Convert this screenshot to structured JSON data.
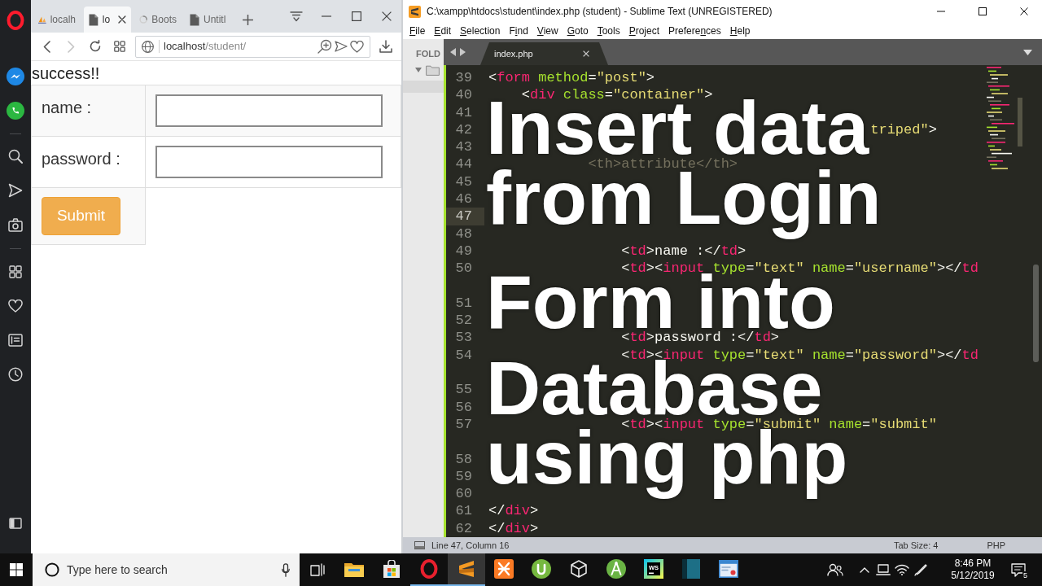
{
  "browser": {
    "tabs": [
      {
        "kind": "sails",
        "label": "localh",
        "selected": false
      },
      {
        "kind": "page",
        "label": "lo",
        "selected": true
      },
      {
        "kind": "loading",
        "label": "Boots",
        "selected": false
      },
      {
        "kind": "page",
        "label": "Untitl",
        "selected": false
      }
    ],
    "nav_buttons": [
      {
        "kind": "back",
        "disabled": false
      },
      {
        "kind": "forward",
        "disabled": true
      },
      {
        "kind": "reload",
        "disabled": false
      },
      {
        "kind": "grid",
        "disabled": false
      }
    ],
    "address": {
      "host": "localhost",
      "path": "/student/"
    },
    "page": {
      "message": "success!!",
      "rows": [
        {
          "kind": "input",
          "label": "name :"
        },
        {
          "kind": "input",
          "label": "password :"
        },
        {
          "kind": "submit",
          "button": "Submit"
        }
      ]
    }
  },
  "editor": {
    "title": "C:\\xampp\\htdocs\\student\\index.php (student) - Sublime Text (UNREGISTERED)",
    "menu": [
      {
        "key": "F",
        "after": "ile"
      },
      {
        "key": "E",
        "after": "dit"
      },
      {
        "key": "S",
        "after": "election"
      },
      {
        "before": "F",
        "key": "i",
        "after": "nd"
      },
      {
        "key": "V",
        "after": "iew"
      },
      {
        "key": "G",
        "after": "oto"
      },
      {
        "key": "T",
        "after": "ools"
      },
      {
        "key": "P",
        "after": "roject"
      },
      {
        "before": "Prefere",
        "key": "n",
        "after": "ces"
      },
      {
        "key": "H",
        "after": "elp"
      }
    ],
    "sidebar": {
      "heading": "FOLD"
    },
    "tab": {
      "label": "index.php"
    },
    "lines": [
      {
        "number": "39",
        "current": false,
        "wrapped": false,
        "code": [
          {
            "kind": "plain",
            "text": "<"
          },
          {
            "kind": "tag",
            "text": "form"
          },
          {
            "kind": "attr",
            "text": " method"
          },
          {
            "kind": "plain",
            "text": "="
          },
          {
            "kind": "string",
            "text": "\"post\""
          },
          {
            "kind": "plain",
            "text": ">"
          }
        ],
        "children": [
          {
            "number": "40",
            "current": false,
            "wrapped": false,
            "code": [
              {
                "kind": "plain",
                "text": "<"
              },
              {
                "kind": "tag",
                "text": "div"
              },
              {
                "kind": "attr",
                "text": " class"
              },
              {
                "kind": "plain",
                "text": "="
              },
              {
                "kind": "string",
                "text": "\"container\""
              },
              {
                "kind": "plain",
                "text": ">"
              }
            ],
            "children": [
              {
                "number": "41",
                "current": false,
                "wrapped": false
              }
            ]
          },
          {
            "number": "42",
            "current": false,
            "wrapped": false,
            "code": [
              {
                "kind": "string",
                "text": "triped\""
              },
              {
                "kind": "plain",
                "text": ">"
              }
            ],
            "children": [
              {
                "number": "43",
                "current": false,
                "wrapped": false,
                "children": [
                  {
                    "number": "44",
                    "current": false,
                    "wrapped": false,
                    "code": [
                      {
                        "kind": "comment",
                        "text": "<th>attribute</th>"
                      }
                    ]
                  },
                  {
                    "number": "45",
                    "current": false,
                    "wrapped": false
                  }
                ]
              },
              {
                "number": "46",
                "current": false,
                "wrapped": false
              },
              {
                "number": "47",
                "current": true,
                "wrapped": false,
                "children": [
                  {
                    "number": "48",
                    "current": false,
                    "wrapped": false,
                    "children": [
                      {
                        "number": "49",
                        "current": false,
                        "wrapped": false,
                        "code": [
                          {
                            "kind": "plain",
                            "text": "<"
                          },
                          {
                            "kind": "tag",
                            "text": "td"
                          },
                          {
                            "kind": "plain",
                            "text": ">name :</"
                          },
                          {
                            "kind": "tag",
                            "text": "td"
                          },
                          {
                            "kind": "plain",
                            "text": ">"
                          }
                        ]
                      },
                      {
                        "number": "50",
                        "current": false,
                        "wrapped": true,
                        "code": [
                          {
                            "kind": "plain",
                            "text": "<"
                          },
                          {
                            "kind": "tag",
                            "text": "td"
                          },
                          {
                            "kind": "plain",
                            "text": "><"
                          },
                          {
                            "kind": "tag",
                            "text": "input"
                          },
                          {
                            "kind": "attr",
                            "text": " type"
                          },
                          {
                            "kind": "plain",
                            "text": "="
                          },
                          {
                            "kind": "string",
                            "text": "\"text\""
                          },
                          {
                            "kind": "attr",
                            "text": " name"
                          },
                          {
                            "kind": "plain",
                            "text": "="
                          },
                          {
                            "kind": "string",
                            "text": "\"username\""
                          },
                          {
                            "kind": "plain",
                            "text": "></"
                          },
                          {
                            "kind": "tag",
                            "text": "td"
                          }
                        ]
                      }
                    ]
                  },
                  {
                    "number": "51",
                    "current": false,
                    "wrapped": false
                  },
                  {
                    "number": "52",
                    "current": false,
                    "wrapped": false,
                    "children": [
                      {
                        "number": "53",
                        "current": false,
                        "wrapped": false,
                        "code": [
                          {
                            "kind": "plain",
                            "text": "<"
                          },
                          {
                            "kind": "tag",
                            "text": "td"
                          },
                          {
                            "kind": "plain",
                            "text": ">password :</"
                          },
                          {
                            "kind": "tag",
                            "text": "td"
                          },
                          {
                            "kind": "plain",
                            "text": ">"
                          }
                        ]
                      },
                      {
                        "number": "54",
                        "current": false,
                        "wrapped": true,
                        "code": [
                          {
                            "kind": "plain",
                            "text": "<"
                          },
                          {
                            "kind": "tag",
                            "text": "td"
                          },
                          {
                            "kind": "plain",
                            "text": "><"
                          },
                          {
                            "kind": "tag",
                            "text": "input"
                          },
                          {
                            "kind": "attr",
                            "text": " type"
                          },
                          {
                            "kind": "plain",
                            "text": "="
                          },
                          {
                            "kind": "string",
                            "text": "\"text\""
                          },
                          {
                            "kind": "attr",
                            "text": " name"
                          },
                          {
                            "kind": "plain",
                            "text": "="
                          },
                          {
                            "kind": "string",
                            "text": "\"password\""
                          },
                          {
                            "kind": "plain",
                            "text": "></"
                          },
                          {
                            "kind": "tag",
                            "text": "td"
                          }
                        ]
                      }
                    ]
                  },
                  {
                    "number": "55",
                    "current": false,
                    "wrapped": false
                  },
                  {
                    "number": "56",
                    "current": false,
                    "wrapped": false,
                    "children": [
                      {
                        "number": "57",
                        "current": false,
                        "wrapped": true,
                        "code": [
                          {
                            "kind": "plain",
                            "text": "<"
                          },
                          {
                            "kind": "tag",
                            "text": "td"
                          },
                          {
                            "kind": "plain",
                            "text": "><"
                          },
                          {
                            "kind": "tag",
                            "text": "input"
                          },
                          {
                            "kind": "attr",
                            "text": " type"
                          },
                          {
                            "kind": "plain",
                            "text": "="
                          },
                          {
                            "kind": "string",
                            "text": "\"submit\""
                          },
                          {
                            "kind": "attr",
                            "text": " name"
                          },
                          {
                            "kind": "plain",
                            "text": "="
                          },
                          {
                            "kind": "string",
                            "text": "\"submit\""
                          }
                        ]
                      }
                    ]
                  },
                  {
                    "number": "58",
                    "current": false,
                    "wrapped": false
                  }
                ]
              },
              {
                "number": "59",
                "current": false,
                "wrapped": false
              }
            ]
          },
          {
            "number": "60",
            "current": false,
            "wrapped": false
          }
        ]
      },
      {
        "number": "61",
        "current": false,
        "wrapped": false,
        "code": [
          {
            "kind": "plain",
            "text": "</"
          },
          {
            "kind": "tag",
            "text": "div"
          },
          {
            "kind": "plain",
            "text": ">"
          }
        ]
      },
      {
        "number": "62",
        "current": false,
        "wrapped": false,
        "code": [
          {
            "kind": "plain",
            "text": "</"
          },
          {
            "kind": "tag",
            "text": "div"
          },
          {
            "kind": "plain",
            "text": ">"
          }
        ]
      }
    ],
    "overlay_title_lines": [
      "Insert data",
      "from Login",
      "Form into",
      "Database",
      "using php"
    ],
    "status": {
      "position": "Line 47, Column 16",
      "tab_size": "Tab Size: 4",
      "syntax": "PHP"
    }
  },
  "taskbar": {
    "search": {
      "placeholder": "Type here to search"
    },
    "apps": [
      {
        "kind": "folder",
        "running": false,
        "active": false
      },
      {
        "kind": "bag",
        "running": false,
        "active": false
      },
      {
        "kind": "ring",
        "running": true,
        "active": false
      },
      {
        "kind": "stripes",
        "running": true,
        "active": true
      },
      {
        "kind": "cross",
        "running": false,
        "active": false
      },
      {
        "kind": "circle",
        "running": false,
        "active": false
      },
      {
        "kind": "cube",
        "running": false,
        "active": false
      },
      {
        "kind": "compass",
        "running": false,
        "active": false
      },
      {
        "kind": "tile",
        "logo_text": "WS",
        "running": false,
        "active": false
      },
      {
        "kind": "panel",
        "running": false,
        "active": false
      },
      {
        "kind": "window",
        "running": false,
        "active": false
      }
    ],
    "clock": {
      "time": "8:46 PM",
      "date": "5/12/2019"
    },
    "notifications": "5"
  }
}
